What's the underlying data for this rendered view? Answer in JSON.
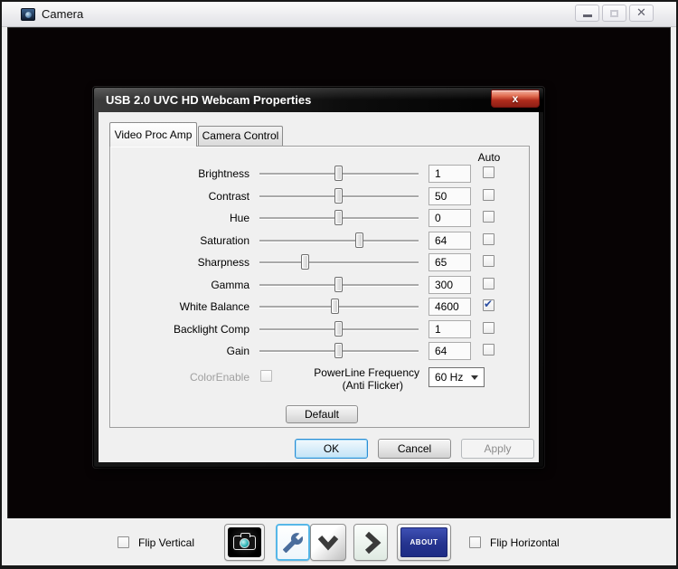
{
  "window": {
    "title": "Camera"
  },
  "dialog": {
    "title": "USB 2.0 UVC HD Webcam Properties",
    "close_glyph": "x",
    "tabs": [
      {
        "label": "Video Proc Amp",
        "active": true
      },
      {
        "label": "Camera Control",
        "active": false
      }
    ],
    "auto_header": "Auto",
    "sliders": [
      {
        "label": "Brightness",
        "value": "1",
        "pos": 0.5,
        "auto": false
      },
      {
        "label": "Contrast",
        "value": "50",
        "pos": 0.5,
        "auto": false
      },
      {
        "label": "Hue",
        "value": "0",
        "pos": 0.5,
        "auto": false
      },
      {
        "label": "Saturation",
        "value": "64",
        "pos": 0.63,
        "auto": false
      },
      {
        "label": "Sharpness",
        "value": "65",
        "pos": 0.29,
        "auto": false
      },
      {
        "label": "Gamma",
        "value": "300",
        "pos": 0.5,
        "auto": false
      },
      {
        "label": "White Balance",
        "value": "4600",
        "pos": 0.48,
        "auto": true
      },
      {
        "label": "Backlight Comp",
        "value": "1",
        "pos": 0.5,
        "auto": false
      },
      {
        "label": "Gain",
        "value": "64",
        "pos": 0.5,
        "auto": false
      }
    ],
    "color_enable_label": "ColorEnable",
    "powerline_label_line1": "PowerLine Frequency",
    "powerline_label_line2": "(Anti Flicker)",
    "powerline_value": "60 Hz",
    "default_button": "Default",
    "ok_button": "OK",
    "cancel_button": "Cancel",
    "apply_button": "Apply"
  },
  "toolbar": {
    "flip_vertical_label": "Flip Vertical",
    "flip_horizontal_label": "Flip Horizontal",
    "about_button": "ABOUT"
  },
  "colors": {
    "dialog_close_red": "#b02c1c",
    "about_blue": "#25348f",
    "ok_focus_border": "#2a8dd4",
    "checkmark_blue": "#2b4ea2",
    "wrench_steel_blue": "#4a6d9c",
    "lens_teal": "#34b7b9"
  }
}
